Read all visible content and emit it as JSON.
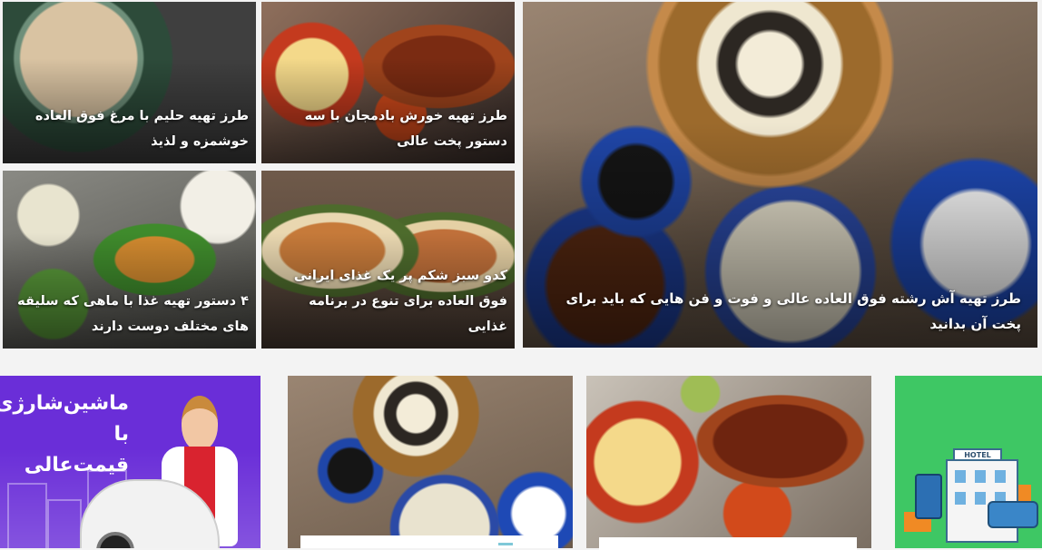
{
  "featured": {
    "main": {
      "title": "طرز تهیه آش رشته فوق العاده عالی و فوت و فن هایی که باید برای پخت آن بدانید",
      "image_icon": "ash-reshteh-image"
    },
    "items": [
      {
        "title": "طرز تهیه خورش بادمجان با سه دستور پخت عالی",
        "image_icon": "eggplant-stew-image"
      },
      {
        "title": "طرز تهیه حلیم با مرغ فوق العاده خوشمزه و لذیذ",
        "image_icon": "haleem-image"
      },
      {
        "title": "کدو سبز شکم پر یک غذای ایرانی فوق العاده برای تنوع در برنامه غذایی",
        "image_icon": "stuffed-zucchini-image"
      },
      {
        "title": "۴ دستور تهیه غذا با ماهی که سلیقه های مختلف دوست دارند",
        "image_icon": "fish-dishes-image"
      }
    ]
  },
  "ads": {
    "left": {
      "text": "ماشین‌شارژی با قیمت‌عالی",
      "icon": "electric-toy-car-image"
    },
    "right": {
      "sign": "HOTEL",
      "icon": "hotel-illustration"
    }
  },
  "cards": [
    {
      "image_icon": "ash-reshteh-image"
    },
    {
      "image_icon": "eggplant-stew-image"
    }
  ]
}
